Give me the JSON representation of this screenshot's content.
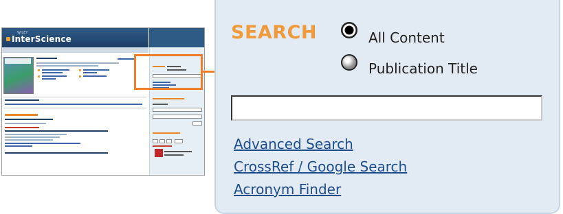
{
  "thumbnail": {
    "logo_small": "WILEY",
    "logo": "InterScience",
    "search_mini_label": "SEARCH",
    "colors": {
      "header": "#2e5a86",
      "sidebar": "#e6eef6",
      "accent": "#e8862a"
    }
  },
  "search": {
    "title": "SEARCH",
    "options": [
      {
        "label": "All Content",
        "selected": true
      },
      {
        "label": "Publication Title",
        "selected": false
      }
    ],
    "input_value": "",
    "links": [
      "Advanced Search",
      "CrossRef / Google Search",
      "Acronym Finder"
    ],
    "colors": {
      "title": "#f09a3a",
      "link": "#1f4e8c",
      "panel": "#e2ebf4",
      "highlight": "#ef7e2a"
    }
  }
}
